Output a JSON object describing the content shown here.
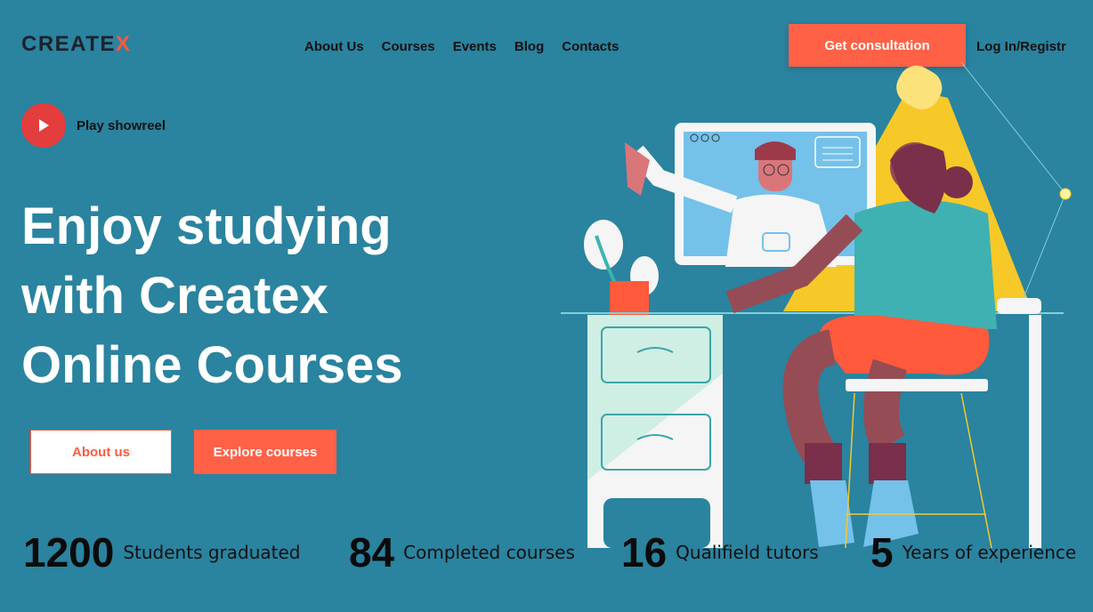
{
  "logo": {
    "text_main": "CREATE",
    "text_accent": "X"
  },
  "nav": {
    "items": [
      "About Us",
      "Courses",
      "Events",
      "Blog",
      "Contacts"
    ]
  },
  "header": {
    "consult_label": "Get consultation",
    "login_label": "Log In/Registr"
  },
  "showreel": {
    "label": "Play showreel",
    "icon": "play-icon"
  },
  "hero": {
    "line1": "Enjoy studying",
    "line2": "with Createx",
    "line3": "Online Courses"
  },
  "buttons": {
    "about_label": "About us",
    "explore_label": "Explore courses"
  },
  "stats": [
    {
      "number": "1200",
      "label": "Students graduated"
    },
    {
      "number": "84",
      "label": "Completed courses"
    },
    {
      "number": "16",
      "label": "Qualifield tutors"
    },
    {
      "number": "5",
      "label": "Years of experience"
    }
  ],
  "colors": {
    "background": "#2a839f",
    "accent": "#ff6147",
    "text_dark": "#1e212c"
  }
}
